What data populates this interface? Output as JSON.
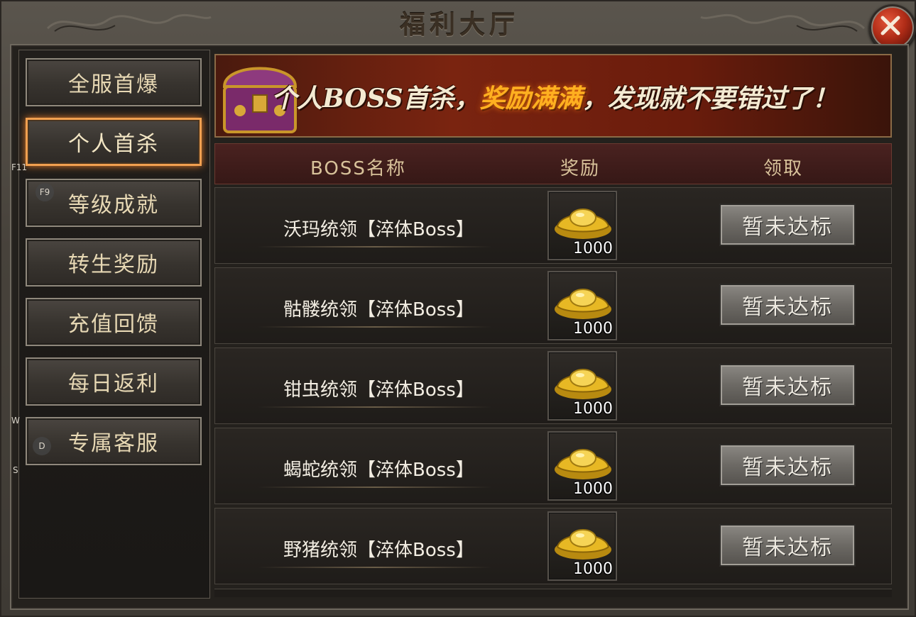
{
  "window": {
    "title": "福利大厅",
    "close_icon": "close-icon"
  },
  "sidebar": {
    "items": [
      {
        "label": "全服首爆",
        "active": false
      },
      {
        "label": "个人首杀",
        "active": true
      },
      {
        "label": "等级成就",
        "active": false
      },
      {
        "label": "转生奖励",
        "active": false
      },
      {
        "label": "充值回馈",
        "active": false
      },
      {
        "label": "每日返利",
        "active": false
      },
      {
        "label": "专属客服",
        "active": false
      }
    ]
  },
  "key_hints": {
    "f11": "F11",
    "f9": "F9",
    "w": "W",
    "d": "D",
    "s": "S"
  },
  "banner": {
    "text_before": "个人BOSS首杀，",
    "text_highlight": "奖励满满",
    "text_after": "，发现就不要错过了！",
    "icon": "treasure-chest-icon"
  },
  "table": {
    "headers": {
      "name": "BOSS名称",
      "reward": "奖励",
      "claim": "领取"
    },
    "rows": [
      {
        "name": "沃玛统领【淬体Boss】",
        "reward_icon": "gold-ingot-icon",
        "reward_count": "1000",
        "claim_label": "暂未达标"
      },
      {
        "name": "骷髅统领【淬体Boss】",
        "reward_icon": "gold-ingot-icon",
        "reward_count": "1000",
        "claim_label": "暂未达标"
      },
      {
        "name": "钳虫统领【淬体Boss】",
        "reward_icon": "gold-ingot-icon",
        "reward_count": "1000",
        "claim_label": "暂未达标"
      },
      {
        "name": "蝎蛇统领【淬体Boss】",
        "reward_icon": "gold-ingot-icon",
        "reward_count": "1000",
        "claim_label": "暂未达标"
      },
      {
        "name": "野猪统领【淬体Boss】",
        "reward_icon": "gold-ingot-icon",
        "reward_count": "1000",
        "claim_label": "暂未达标"
      }
    ]
  },
  "colors": {
    "accent": "#f1a050",
    "highlight": "#ffb020",
    "text": "#e7d8b4"
  }
}
